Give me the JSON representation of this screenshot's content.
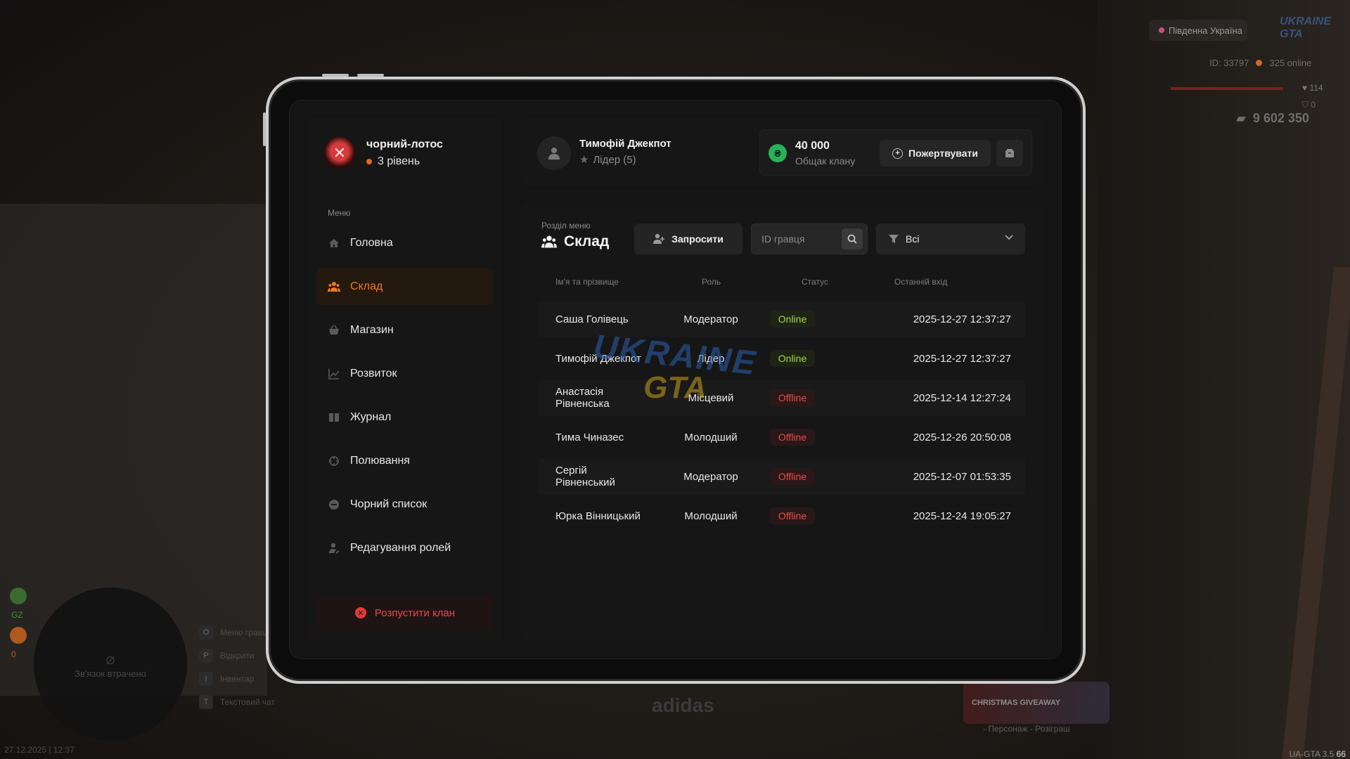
{
  "hud": {
    "server": "Південна Україна",
    "logo": "UKRAINE GTA",
    "player_id": "ID: 33797",
    "online": "325 online",
    "hp": "114",
    "armor": "0",
    "money": "9 602 350",
    "minimap_text": "Зв'язок втрачено",
    "badge_g": "GZ",
    "badge_o": "0",
    "hotkeys": [
      {
        "key": "O",
        "label": "Меню гравця"
      },
      {
        "key": "P",
        "label": "Відкрити"
      },
      {
        "key": "I",
        "label": "Інвентар"
      },
      {
        "key": "T",
        "label": "Текстовий чат"
      }
    ],
    "datetime": "27.12.2025 | 12:37",
    "version": "UA-GTA 3.5",
    "fps": "66",
    "xmas_label": "CHRISTMAS GIVEAWAY",
    "xmas_caption": "- Персонаж - Розіграш",
    "shirt_text": "adidas"
  },
  "clan": {
    "name": "чорний-лотос",
    "level": "3 рівень"
  },
  "menu": {
    "caption": "Меню",
    "items": [
      {
        "label": "Головна",
        "icon": "home-icon"
      },
      {
        "label": "Склад",
        "icon": "people-icon",
        "active": true
      },
      {
        "label": "Магазин",
        "icon": "basket-icon"
      },
      {
        "label": "Розвиток",
        "icon": "chart-icon"
      },
      {
        "label": "Журнал",
        "icon": "book-icon"
      },
      {
        "label": "Полювання",
        "icon": "crosshair-icon"
      },
      {
        "label": "Чорний список",
        "icon": "ban-icon"
      },
      {
        "label": "Редагування ролей",
        "icon": "user-edit-icon"
      }
    ],
    "disband_label": "Розпустити клан"
  },
  "user": {
    "name": "Тимофій Джекпот",
    "role": "Лідер (5)"
  },
  "treasury": {
    "amount": "40 000",
    "label": "Общак клану",
    "currency_symbol": "₴",
    "donate_label": "Пожертвувати"
  },
  "section": {
    "caption": "Розділ меню",
    "title": "Склад",
    "invite_label": "Запросити",
    "id_placeholder": "ID гравця",
    "filter_value": "Всі"
  },
  "table": {
    "headers": {
      "name": "Ім'я та прізвище",
      "role": "Роль",
      "status": "Статус",
      "last": "Останній вхід"
    },
    "rows": [
      {
        "name": "Саша Голівець",
        "role": "Модератор",
        "status": "Online",
        "last": "2025-12-27 12:37:27"
      },
      {
        "name": "Тимофій Джекпот",
        "role": "Лідер",
        "status": "Online",
        "last": "2025-12-27 12:37:27"
      },
      {
        "name": "Анастасія Рівненська",
        "role": "Місцевий",
        "status": "Offline",
        "last": "2025-12-14 12:27:24"
      },
      {
        "name": "Тима Чиназес",
        "role": "Молодший",
        "status": "Offline",
        "last": "2025-12-26 20:50:08"
      },
      {
        "name": "Сергій Рівненський",
        "role": "Модератор",
        "status": "Offline",
        "last": "2025-12-07 01:53:35"
      },
      {
        "name": "Юрка Вінницький",
        "role": "Молодший",
        "status": "Offline",
        "last": "2025-12-24 19:05:27"
      }
    ]
  },
  "watermark": {
    "line1": "UKRAINE",
    "line2": "GTA"
  },
  "colors": {
    "accent": "#f07a20",
    "online": "#a6d34a",
    "offline": "#e84a4a",
    "coin": "#2bb05a"
  }
}
